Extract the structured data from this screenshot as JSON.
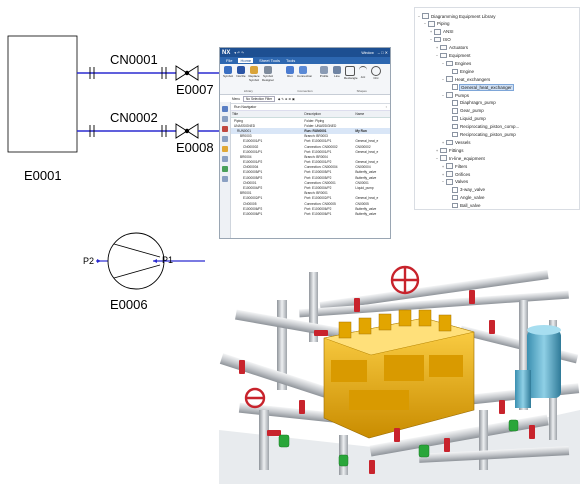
{
  "schematic": {
    "equipment": [
      "E0001",
      "E0007",
      "E0008",
      "E0006"
    ],
    "connections": [
      "CN0001",
      "CN0002"
    ],
    "ports": [
      "P2",
      "P1"
    ]
  },
  "nx_window": {
    "logo": "NX",
    "window_menu": "Window",
    "menu": [
      "File",
      "Home",
      "Sheet Tools",
      "Tools"
    ],
    "ribbon_buttons": [
      "Symbol",
      "Nozzle",
      "Replace Symbol",
      "Symbol Designer",
      "Run",
      "Connection",
      "Profile",
      "Line",
      "Rectangle",
      "Arc",
      "Circ"
    ],
    "ribbon_groups": [
      "Library",
      "Connection",
      "Shapes"
    ],
    "filter": {
      "menu": "Menu",
      "value": "No Selection Filter"
    },
    "panel_title": "Run Navigator",
    "columns": [
      "Title",
      "Description",
      "Name"
    ],
    "rows": [
      [
        "Piping",
        "Folder: Piping",
        ""
      ],
      [
        "UNASSIGNED",
        "Folder: UNASSIGNED",
        ""
      ],
      [
        "RUN0001",
        "Run: RUN0001",
        "My Run"
      ],
      [
        "BR0003",
        "Branch: BR0003",
        ""
      ],
      [
        "E1000001/P1",
        "Port: E1000001/P1",
        "General_heat_e"
      ],
      [
        "CN000002",
        "Connection: CN000002",
        "CN000002"
      ],
      [
        "E1000001/P1",
        "Port: E1000001/P1",
        "General_heat_e"
      ],
      [
        "BR0004",
        "Branch: BR0004",
        ""
      ],
      [
        "E1000001/P2",
        "Port: E1000001/P2",
        "General_heat_e"
      ],
      [
        "CN000004",
        "Connection: CN000004",
        "CN000004"
      ],
      [
        "E1000005/P1",
        "Port: E1000005/P1",
        "Butterfly_valve"
      ],
      [
        "E1000005/P2",
        "Port: E1000005/P2",
        "Butterfly_valve"
      ],
      [
        "CN00001",
        "Connection: CN00001",
        "CN00001"
      ],
      [
        "E1000004/P2",
        "Port: E1000004/P2",
        "Liquid_pump"
      ],
      [
        "BR0001",
        "Branch: BR0001",
        ""
      ],
      [
        "E1000002/P1",
        "Port: E1000002/P1",
        "General_heat_e"
      ],
      [
        "CN00005",
        "Connection: CN00005",
        "CN00005"
      ],
      [
        "E1000006/P2",
        "Port: E1000006/P2",
        "Butterfly_valve"
      ],
      [
        "E1000006/P1",
        "Port: E1000006/P1",
        "Butterfly_valve"
      ]
    ]
  },
  "library": {
    "items": [
      {
        "label": "Diagramming Equipment Library",
        "depth": 0,
        "toggle": "−"
      },
      {
        "label": "Piping",
        "depth": 1,
        "toggle": "−"
      },
      {
        "label": "ANSI",
        "depth": 2,
        "toggle": "+"
      },
      {
        "label": "ISO",
        "depth": 2,
        "toggle": "−"
      },
      {
        "label": "Actuators",
        "depth": 3,
        "toggle": "+"
      },
      {
        "label": "Equipment",
        "depth": 3,
        "toggle": "−"
      },
      {
        "label": "Engines",
        "depth": 4,
        "toggle": "−"
      },
      {
        "label": "Engine",
        "depth": 5,
        "toggle": ""
      },
      {
        "label": "Heat_exchangers",
        "depth": 4,
        "toggle": "−"
      },
      {
        "label": "General_heat_exchanger",
        "depth": 5,
        "toggle": "",
        "selected": true
      },
      {
        "label": "Pumps",
        "depth": 4,
        "toggle": "−"
      },
      {
        "label": "Diaphragm_pump",
        "depth": 5,
        "toggle": ""
      },
      {
        "label": "Gear_pump",
        "depth": 5,
        "toggle": ""
      },
      {
        "label": "Liquid_pump",
        "depth": 5,
        "toggle": ""
      },
      {
        "label": "Reciprocating_piston_comp...",
        "depth": 5,
        "toggle": ""
      },
      {
        "label": "Reciprocating_piston_pump",
        "depth": 5,
        "toggle": ""
      },
      {
        "label": "Vessels",
        "depth": 4,
        "toggle": "+"
      },
      {
        "label": "Fittings",
        "depth": 3,
        "toggle": "+"
      },
      {
        "label": "In-line_equipment",
        "depth": 3,
        "toggle": "−"
      },
      {
        "label": "Filters",
        "depth": 4,
        "toggle": "+"
      },
      {
        "label": "Orifices",
        "depth": 4,
        "toggle": "+"
      },
      {
        "label": "Valves",
        "depth": 4,
        "toggle": "−"
      },
      {
        "label": "3-way_valve",
        "depth": 5,
        "toggle": ""
      },
      {
        "label": "Angle_valve",
        "depth": 5,
        "toggle": ""
      },
      {
        "label": "Ball_valve",
        "depth": 5,
        "toggle": ""
      }
    ]
  },
  "colors": {
    "line_blue": "#2b2bd1",
    "nx_blue": "#1d4f91",
    "pipe_gray": "#c9ccd0",
    "flange_red": "#c8232c",
    "engine_yellow": "#f2b400",
    "valve_green": "#2aa63a"
  }
}
